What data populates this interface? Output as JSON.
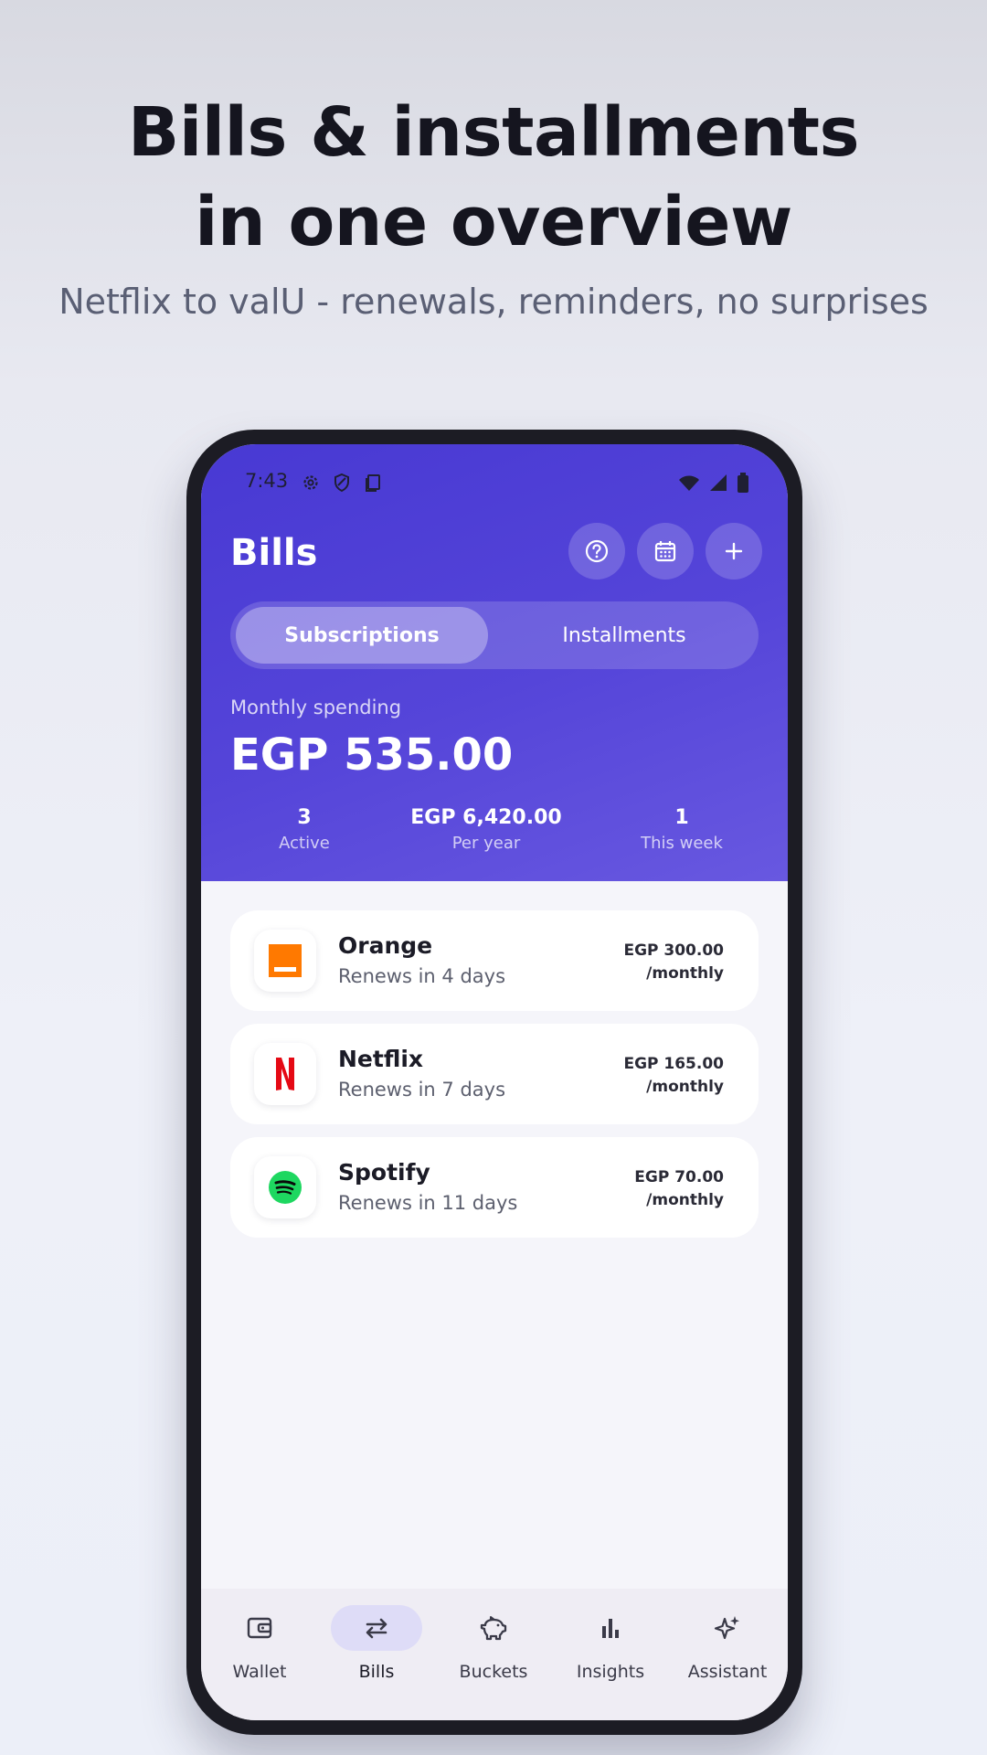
{
  "promo": {
    "headline_line1": "Bills & installments",
    "headline_line2": "in one overview",
    "subtitle": "Netflix to valU - renewals, reminders, no surprises"
  },
  "status_bar": {
    "time": "7:43",
    "left_icons": [
      "gear-icon",
      "shield-icon",
      "clipboard-icon"
    ],
    "right_icons": [
      "wifi-icon",
      "signal-icon",
      "battery-icon"
    ]
  },
  "header": {
    "title": "Bills",
    "actions": [
      "help-icon",
      "calendar-icon",
      "plus-icon"
    ]
  },
  "tabs": [
    {
      "label": "Subscriptions",
      "active": true
    },
    {
      "label": "Installments",
      "active": false
    }
  ],
  "summary": {
    "label": "Monthly spending",
    "amount": "EGP 535.00",
    "stats": [
      {
        "value": "3",
        "label": "Active"
      },
      {
        "value": "EGP 6,420.00",
        "label": "Per year"
      },
      {
        "value": "1",
        "label": "This week"
      }
    ]
  },
  "subscriptions": [
    {
      "name": "Orange",
      "renewal": "Renews in 4 days",
      "price": "EGP 300.00",
      "period": "/monthly",
      "logo": "orange-logo-icon",
      "color": "#ff7900"
    },
    {
      "name": "Netflix",
      "renewal": "Renews in 7 days",
      "price": "EGP 165.00",
      "period": "/monthly",
      "logo": "netflix-logo-icon",
      "color": "#e50914"
    },
    {
      "name": "Spotify",
      "renewal": "Renews in 11 days",
      "price": "EGP 70.00",
      "period": "/monthly",
      "logo": "spotify-logo-icon",
      "color": "#1ed760"
    }
  ],
  "bottom_nav": [
    {
      "label": "Wallet",
      "icon": "wallet-icon",
      "active": false
    },
    {
      "label": "Bills",
      "icon": "repeat-icon",
      "active": true
    },
    {
      "label": "Buckets",
      "icon": "piggy-bank-icon",
      "active": false
    },
    {
      "label": "Insights",
      "icon": "bar-chart-icon",
      "active": false
    },
    {
      "label": "Assistant",
      "icon": "sparkle-icon",
      "active": false
    }
  ],
  "colors": {
    "accent": "#4f40d6",
    "page_background": "#eef0f8",
    "nav_active_pill": "#dedcf7"
  }
}
